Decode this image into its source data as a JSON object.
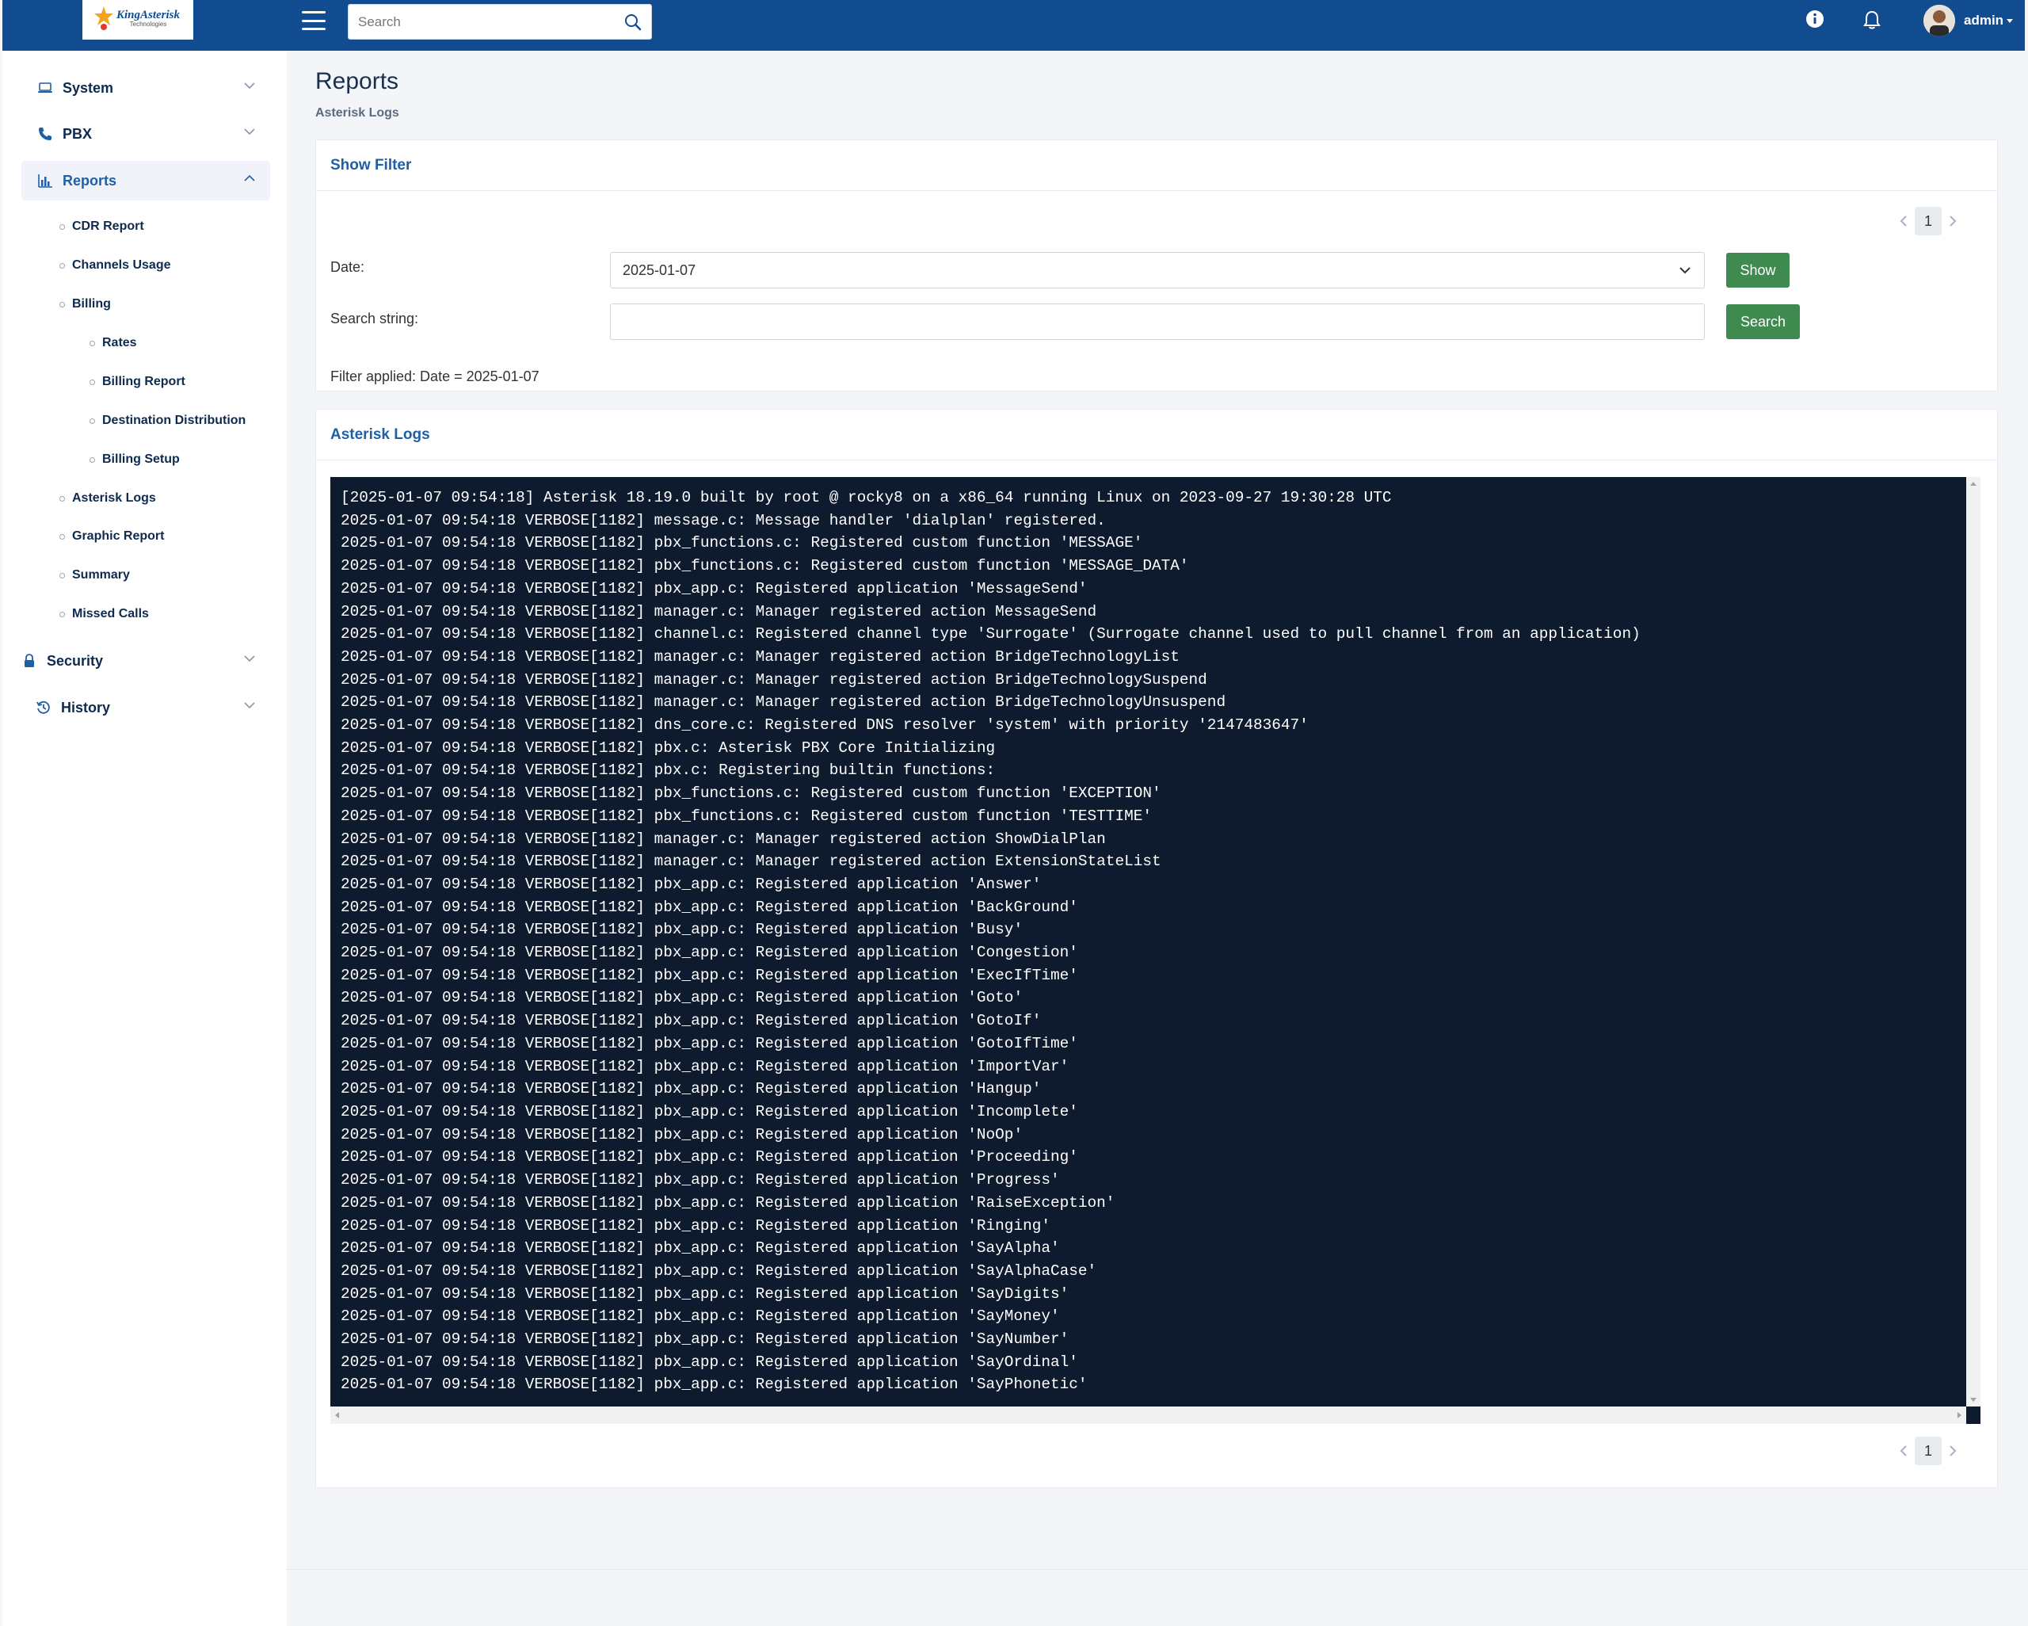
{
  "header": {
    "logo_text": "KingAsterisk",
    "logo_sub": "Technologies",
    "search_placeholder": "Search",
    "user_name": "admin"
  },
  "sidebar": {
    "items": [
      {
        "label": "System",
        "icon": "laptop-icon"
      },
      {
        "label": "PBX",
        "icon": "phone-icon"
      },
      {
        "label": "Reports",
        "icon": "bar-chart-icon"
      },
      {
        "label": "Security",
        "icon": "lock-icon"
      },
      {
        "label": "History",
        "icon": "history-icon"
      }
    ],
    "reports_sub": [
      "CDR Report",
      "Channels Usage",
      "Billing",
      "Asterisk Logs",
      "Graphic Report",
      "Summary",
      "Missed Calls"
    ],
    "billing_sub": [
      "Rates",
      "Billing Report",
      "Destination Distribution",
      "Billing Setup"
    ]
  },
  "page": {
    "title": "Reports",
    "breadcrumb": "Asterisk Logs"
  },
  "filter": {
    "header": "Show Filter",
    "page": "1",
    "date_label": "Date:",
    "date_value": "2025-01-07",
    "search_label": "Search string:",
    "search_value": "",
    "show_button": "Show",
    "search_button": "Search",
    "applied_text": "Filter applied: Date = 2025-01-07"
  },
  "logs": {
    "header": "Asterisk Logs",
    "page": "1",
    "lines": [
      "[2025-01-07 09:54:18] Asterisk 18.19.0 built by root @ rocky8 on a x86_64 running Linux on 2023-09-27 19:30:28 UTC",
      "2025-01-07 09:54:18 VERBOSE[1182] message.c: Message handler 'dialplan' registered.",
      "2025-01-07 09:54:18 VERBOSE[1182] pbx_functions.c: Registered custom function 'MESSAGE'",
      "2025-01-07 09:54:18 VERBOSE[1182] pbx_functions.c: Registered custom function 'MESSAGE_DATA'",
      "2025-01-07 09:54:18 VERBOSE[1182] pbx_app.c: Registered application 'MessageSend'",
      "2025-01-07 09:54:18 VERBOSE[1182] manager.c: Manager registered action MessageSend",
      "2025-01-07 09:54:18 VERBOSE[1182] channel.c: Registered channel type 'Surrogate' (Surrogate channel used to pull channel from an application)",
      "2025-01-07 09:54:18 VERBOSE[1182] manager.c: Manager registered action BridgeTechnologyList",
      "2025-01-07 09:54:18 VERBOSE[1182] manager.c: Manager registered action BridgeTechnologySuspend",
      "2025-01-07 09:54:18 VERBOSE[1182] manager.c: Manager registered action BridgeTechnologyUnsuspend",
      "2025-01-07 09:54:18 VERBOSE[1182] dns_core.c: Registered DNS resolver 'system' with priority '2147483647'",
      "2025-01-07 09:54:18 VERBOSE[1182] pbx.c: Asterisk PBX Core Initializing",
      "2025-01-07 09:54:18 VERBOSE[1182] pbx.c: Registering builtin functions:",
      "2025-01-07 09:54:18 VERBOSE[1182] pbx_functions.c: Registered custom function 'EXCEPTION'",
      "2025-01-07 09:54:18 VERBOSE[1182] pbx_functions.c: Registered custom function 'TESTTIME'",
      "2025-01-07 09:54:18 VERBOSE[1182] manager.c: Manager registered action ShowDialPlan",
      "2025-01-07 09:54:18 VERBOSE[1182] manager.c: Manager registered action ExtensionStateList",
      "2025-01-07 09:54:18 VERBOSE[1182] pbx_app.c: Registered application 'Answer'",
      "2025-01-07 09:54:18 VERBOSE[1182] pbx_app.c: Registered application 'BackGround'",
      "2025-01-07 09:54:18 VERBOSE[1182] pbx_app.c: Registered application 'Busy'",
      "2025-01-07 09:54:18 VERBOSE[1182] pbx_app.c: Registered application 'Congestion'",
      "2025-01-07 09:54:18 VERBOSE[1182] pbx_app.c: Registered application 'ExecIfTime'",
      "2025-01-07 09:54:18 VERBOSE[1182] pbx_app.c: Registered application 'Goto'",
      "2025-01-07 09:54:18 VERBOSE[1182] pbx_app.c: Registered application 'GotoIf'",
      "2025-01-07 09:54:18 VERBOSE[1182] pbx_app.c: Registered application 'GotoIfTime'",
      "2025-01-07 09:54:18 VERBOSE[1182] pbx_app.c: Registered application 'ImportVar'",
      "2025-01-07 09:54:18 VERBOSE[1182] pbx_app.c: Registered application 'Hangup'",
      "2025-01-07 09:54:18 VERBOSE[1182] pbx_app.c: Registered application 'Incomplete'",
      "2025-01-07 09:54:18 VERBOSE[1182] pbx_app.c: Registered application 'NoOp'",
      "2025-01-07 09:54:18 VERBOSE[1182] pbx_app.c: Registered application 'Proceeding'",
      "2025-01-07 09:54:18 VERBOSE[1182] pbx_app.c: Registered application 'Progress'",
      "2025-01-07 09:54:18 VERBOSE[1182] pbx_app.c: Registered application 'RaiseException'",
      "2025-01-07 09:54:18 VERBOSE[1182] pbx_app.c: Registered application 'Ringing'",
      "2025-01-07 09:54:18 VERBOSE[1182] pbx_app.c: Registered application 'SayAlpha'",
      "2025-01-07 09:54:18 VERBOSE[1182] pbx_app.c: Registered application 'SayAlphaCase'",
      "2025-01-07 09:54:18 VERBOSE[1182] pbx_app.c: Registered application 'SayDigits'",
      "2025-01-07 09:54:18 VERBOSE[1182] pbx_app.c: Registered application 'SayMoney'",
      "2025-01-07 09:54:18 VERBOSE[1182] pbx_app.c: Registered application 'SayNumber'",
      "2025-01-07 09:54:18 VERBOSE[1182] pbx_app.c: Registered application 'SayOrdinal'",
      "2025-01-07 09:54:18 VERBOSE[1182] pbx_app.c: Registered application 'SayPhonetic'"
    ]
  },
  "colors": {
    "topbar": "#114c91",
    "accent": "#1f5fa5",
    "button": "#3f8a4f",
    "log_bg": "#0e1a2e"
  }
}
